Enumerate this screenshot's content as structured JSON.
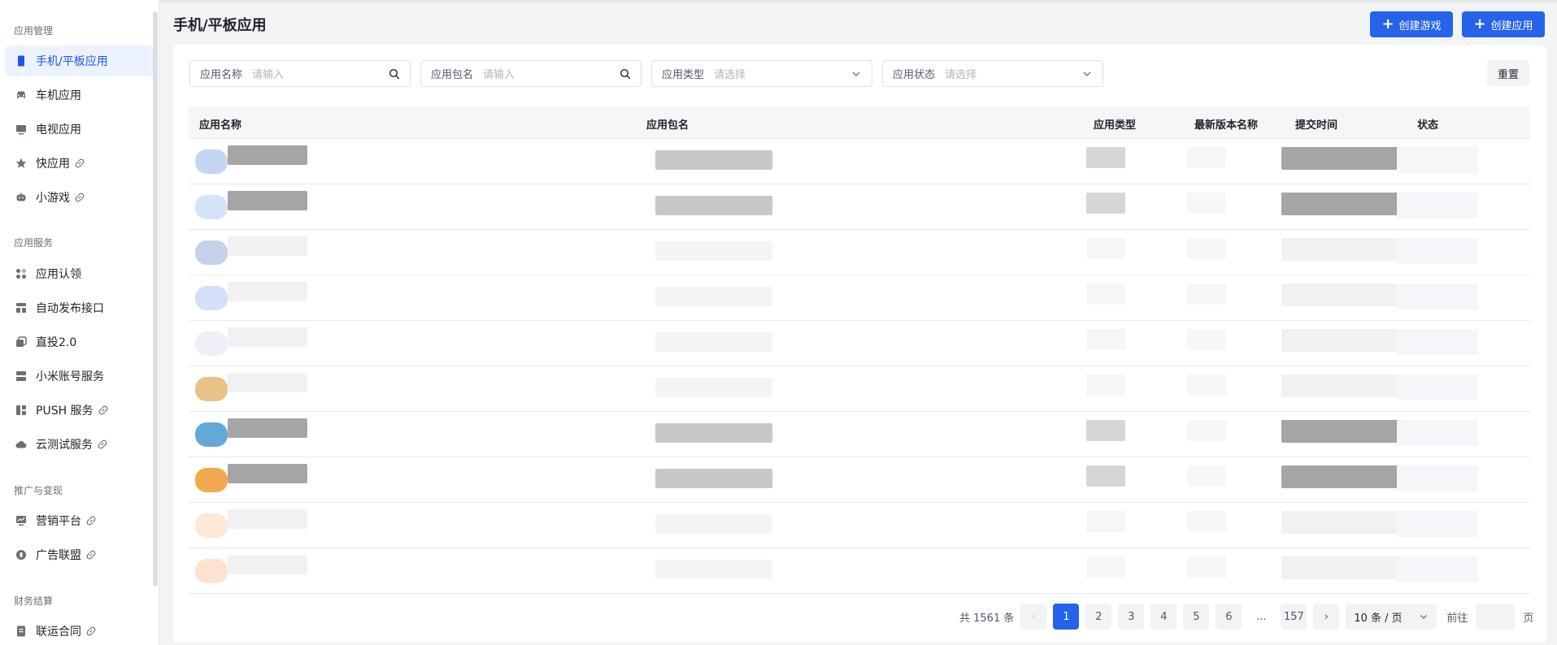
{
  "sidebar": {
    "groups": [
      {
        "title": "应用管理",
        "items": [
          {
            "label": "手机/平板应用",
            "icon": "phone-icon",
            "link": false,
            "active": true
          },
          {
            "label": "车机应用",
            "icon": "car-icon",
            "link": false
          },
          {
            "label": "电视应用",
            "icon": "tv-icon",
            "link": false
          },
          {
            "label": "快应用",
            "icon": "star-icon",
            "link": true
          },
          {
            "label": "小游戏",
            "icon": "gamepad-icon",
            "link": true
          }
        ]
      },
      {
        "title": "应用服务",
        "items": [
          {
            "label": "应用认领",
            "icon": "apps-icon",
            "link": false
          },
          {
            "label": "自动发布接口",
            "icon": "api-icon",
            "link": false
          },
          {
            "label": "直投2.0",
            "icon": "copy-icon",
            "link": false
          },
          {
            "label": "小米账号服务",
            "icon": "server-icon",
            "link": false
          },
          {
            "label": "PUSH 服务",
            "icon": "grid-icon",
            "link": true
          },
          {
            "label": "云测试服务",
            "icon": "cloud-icon",
            "link": true
          }
        ]
      },
      {
        "title": "推广与变现",
        "items": [
          {
            "label": "营销平台",
            "icon": "chart-icon",
            "link": true
          },
          {
            "label": "广告联盟",
            "icon": "coin-icon",
            "link": true
          }
        ]
      },
      {
        "title": "财务结算",
        "items": [
          {
            "label": "联运合同",
            "icon": "contract-icon",
            "link": true
          }
        ]
      }
    ]
  },
  "header": {
    "title": "手机/平板应用",
    "create_game": "创建游戏",
    "create_app": "创建应用"
  },
  "filters": {
    "app_name": {
      "label": "应用名称",
      "placeholder": "请输入"
    },
    "package": {
      "label": "应用包名",
      "placeholder": "请输入"
    },
    "type": {
      "label": "应用类型",
      "placeholder": "请选择"
    },
    "status": {
      "label": "应用状态",
      "placeholder": "请选择"
    },
    "reset": "重置"
  },
  "table": {
    "columns": [
      "应用名称",
      "应用包名",
      "应用类型",
      "最新版本名称",
      "提交时间",
      "状态"
    ],
    "row_count": 10
  },
  "pagination": {
    "total": "共 1561 条",
    "prev": "‹",
    "pages": [
      "1",
      "2",
      "3",
      "4",
      "5",
      "6"
    ],
    "ellipsis": "...",
    "last": "157",
    "next": "›",
    "page_size": "10 条 / 页",
    "jump_label": "前往",
    "page_suffix": "页",
    "current_page": 1
  },
  "colors": {
    "accent": "#2563eb",
    "active_bg": "#ecf2ff"
  }
}
